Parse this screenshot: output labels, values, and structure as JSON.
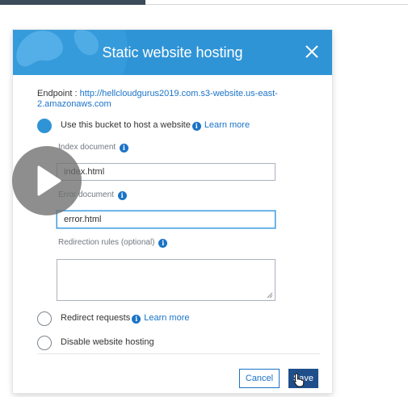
{
  "modal": {
    "title": "Static website hosting",
    "close_icon": "close-icon"
  },
  "endpoint": {
    "label": "Endpoint :",
    "url": "http://hellcloudgurus2019.com.s3-website.us-east-2.amazonaws.com"
  },
  "options": {
    "host": {
      "label": "Use this bucket to host a website",
      "learn_more": "Learn more",
      "selected": true
    },
    "redirect": {
      "label": "Redirect requests",
      "learn_more": "Learn more",
      "selected": false
    },
    "disable": {
      "label": "Disable website hosting",
      "selected": false
    }
  },
  "fields": {
    "index": {
      "label": "Index document",
      "value": "index.html"
    },
    "error": {
      "label": "Error document",
      "value": "error.html"
    },
    "redirection": {
      "label": "Redirection rules (optional)",
      "value": ""
    }
  },
  "buttons": {
    "cancel": "Cancel",
    "save": "Save"
  },
  "colors": {
    "header": "#2f94d6",
    "link": "#1a73c7",
    "save_button": "#1f4e8a",
    "selected_radio": "#2f94d6"
  },
  "overlay": {
    "icon": "play-icon"
  }
}
